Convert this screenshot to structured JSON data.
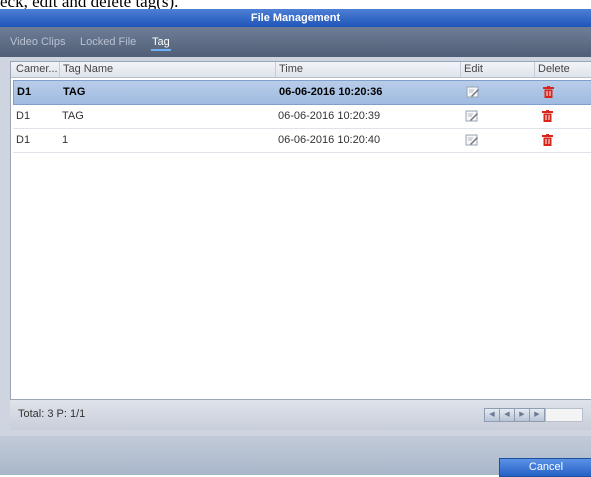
{
  "caption": "eck, edit and delete tag(s).",
  "window": {
    "title": "File Management"
  },
  "tabs": [
    {
      "label": "Video Clips",
      "active": false
    },
    {
      "label": "Locked File",
      "active": false
    },
    {
      "label": "Tag",
      "active": true
    }
  ],
  "table": {
    "columns": [
      "Camer...",
      "Tag Name",
      "Time",
      "Edit",
      "Delete"
    ],
    "rows": [
      {
        "camera": "D1",
        "tag_name": "TAG",
        "time": "06-06-2016 10:20:36",
        "selected": true
      },
      {
        "camera": "D1",
        "tag_name": "TAG",
        "time": "06-06-2016 10:20:39",
        "selected": false
      },
      {
        "camera": "D1",
        "tag_name": "1",
        "time": "06-06-2016 10:20:40",
        "selected": false
      }
    ]
  },
  "footer": {
    "total": "Total: 3 P: 1/1"
  },
  "buttons": {
    "cancel": "Cancel"
  },
  "icons": {
    "edit": "pencil-edit-icon",
    "delete": "trash-icon",
    "pager": [
      "first-page-icon",
      "prev-page-icon",
      "next-page-icon",
      "last-page-icon"
    ]
  },
  "colors": {
    "titlebar": "#2f64c4",
    "selected_row": "#abc4e6",
    "delete_icon": "#d9261c",
    "cancel_button": "#2f6fd6"
  }
}
